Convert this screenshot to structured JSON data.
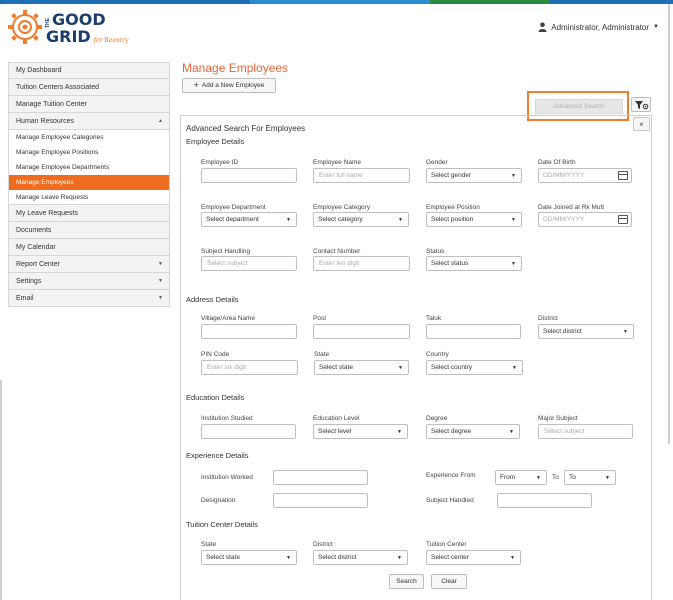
{
  "colors": {
    "accent": "#ef6b1f",
    "title": "#e8663a",
    "highlight_border": "#f07c2e"
  },
  "topbar": {
    "segments": [
      "#1f6fb4",
      "#2a8fd1",
      "#2b8a3e",
      "#1f6fb4"
    ]
  },
  "logo": {
    "line1": "GOOD",
    "prefix": "THE",
    "line2": "GRID",
    "tagline": "for Reentry"
  },
  "header": {
    "user_icon": "user-icon",
    "user_name": "Administrator, Administrator"
  },
  "sidebar": {
    "items": [
      {
        "label": "My Dashboard"
      },
      {
        "label": "Tuition Centers Associated"
      },
      {
        "label": "Manage Tuition Center"
      },
      {
        "label": "Human Resources",
        "expanded": true
      }
    ],
    "sub_items": [
      {
        "label": "Manage Employee Categories"
      },
      {
        "label": "Manage Employee Positions"
      },
      {
        "label": "Manage Employee Departments"
      },
      {
        "label": "Manage Employees",
        "active": true
      },
      {
        "label": "Manage Leave Requests"
      }
    ],
    "items_after": [
      {
        "label": "My Leave Requests"
      },
      {
        "label": "Documents"
      },
      {
        "label": "My Calendar"
      },
      {
        "label": "Report Center",
        "has_arrow": true
      },
      {
        "label": "Settings",
        "has_arrow": true
      },
      {
        "label": "Email",
        "has_arrow": true
      }
    ]
  },
  "main": {
    "title": "Manage Employees",
    "add_button": "Add a New Employee",
    "advanced_search_button": "Advanced Search",
    "close_label": "×"
  },
  "panel": {
    "title": "Advanced Search For Employees",
    "employee_details": {
      "heading": "Employee Details",
      "employee_id": {
        "label": "Employee ID",
        "value": ""
      },
      "employee_name": {
        "label": "Employee Name",
        "placeholder": "Enter full name"
      },
      "gender": {
        "label": "Gender",
        "selected": "Select gender"
      },
      "dob": {
        "label": "Date Of Birth",
        "placeholder": "DD/MM/YYYY"
      },
      "department": {
        "label": "Employee Department",
        "selected": "Select department"
      },
      "category": {
        "label": "Employee Category",
        "selected": "Select category"
      },
      "position": {
        "label": "Employee Position",
        "selected": "Select position"
      },
      "date_joined": {
        "label": "Date Joined at Rk Mutt",
        "placeholder": "DD/MM/YYYY"
      },
      "subject": {
        "label": "Subject Handling",
        "placeholder": "Select subject"
      },
      "contact": {
        "label": "Contact Number",
        "placeholder": "Enter ten digit"
      },
      "status": {
        "label": "Status",
        "selected": "Select status"
      }
    },
    "address_details": {
      "heading": "Address Details",
      "village": {
        "label": "Village/Area Name",
        "value": ""
      },
      "post": {
        "label": "Post",
        "value": ""
      },
      "taluk": {
        "label": "Taluk",
        "value": ""
      },
      "district": {
        "label": "District",
        "selected": "Select district"
      },
      "pin": {
        "label": "PIN Code",
        "placeholder": "Enter six digit"
      },
      "state": {
        "label": "State",
        "selected": "Select state"
      },
      "country": {
        "label": "Country",
        "selected": "Select country"
      }
    },
    "education_details": {
      "heading": "Education Details",
      "institution": {
        "label": "Institution Studied",
        "value": ""
      },
      "level": {
        "label": "Education Level",
        "selected": "Select level"
      },
      "degree": {
        "label": "Degree",
        "selected": "Select degree"
      },
      "major": {
        "label": "Major Subject",
        "placeholder": "Select subject"
      }
    },
    "experience_details": {
      "heading": "Experience Details",
      "institution_worked": {
        "label": "Institution Worked",
        "value": ""
      },
      "experience_from": {
        "label": "Experience From",
        "from": "From",
        "to_label": "To",
        "to": "To"
      },
      "designation": {
        "label": "Designation",
        "value": ""
      },
      "subject_handled": {
        "label": "Subject Handled",
        "value": ""
      }
    },
    "tuition_details": {
      "heading": "Tuition Center Details",
      "state": {
        "label": "State",
        "selected": "Select state"
      },
      "district": {
        "label": "District",
        "selected": "Select district"
      },
      "center": {
        "label": "Tuition Center",
        "selected": "Select center"
      }
    },
    "buttons": {
      "search": "Search",
      "clear": "Clear"
    }
  }
}
